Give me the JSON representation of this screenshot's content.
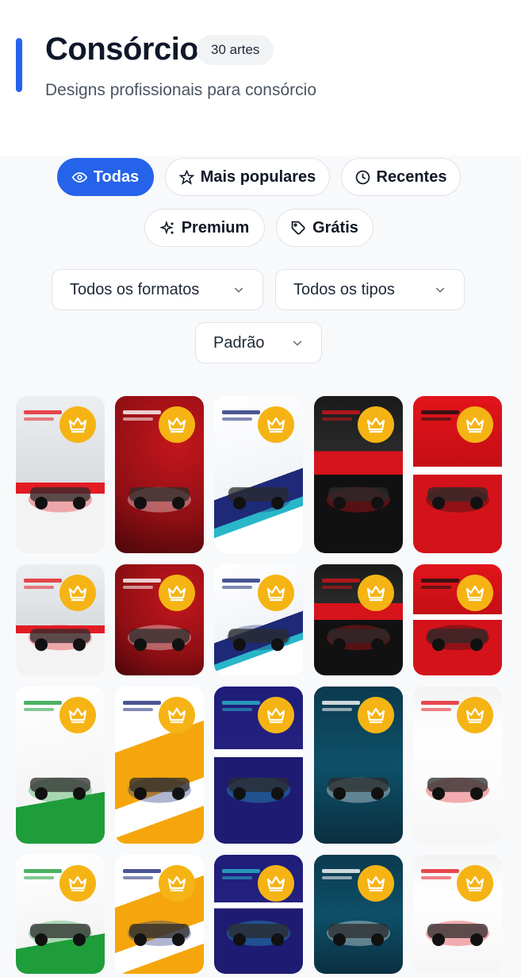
{
  "header": {
    "title": "Consórcio",
    "count_badge": "30 artes",
    "subtitle": "Designs profissionais para consórcio",
    "accent_color": "#2563eb"
  },
  "filters": {
    "tabs": [
      {
        "label": "Todas",
        "icon": "eye-icon",
        "active": true
      },
      {
        "label": "Mais populares",
        "icon": "star-icon",
        "active": false
      },
      {
        "label": "Recentes",
        "icon": "clock-icon",
        "active": false
      },
      {
        "label": "Premium",
        "icon": "sparkles-icon",
        "active": false
      },
      {
        "label": "Grátis",
        "icon": "tag-icon",
        "active": false
      }
    ],
    "format_select": "Todos os formatos",
    "type_select": "Todos os tipos",
    "sort_select": "Padrão"
  },
  "grid": {
    "premium_icon": "crown-icon",
    "crown_color": "#f5b414",
    "cards": [
      {
        "style": "moto-promo"
      },
      {
        "style": "red-scooter"
      },
      {
        "style": "white-cars"
      },
      {
        "style": "dark-moto"
      },
      {
        "style": "red-suv"
      },
      {
        "style": "moto-promo"
      },
      {
        "style": "red-scooter"
      },
      {
        "style": "white-cars"
      },
      {
        "style": "dark-moto"
      },
      {
        "style": "red-suv"
      },
      {
        "style": "green-moto"
      },
      {
        "style": "yellow-suv"
      },
      {
        "style": "navy-cars"
      },
      {
        "style": "teal-suv"
      },
      {
        "style": "honda-red"
      },
      {
        "style": "green-moto"
      },
      {
        "style": "yellow-suv"
      },
      {
        "style": "navy-cars"
      },
      {
        "style": "teal-suv"
      },
      {
        "style": "honda-red"
      }
    ]
  }
}
